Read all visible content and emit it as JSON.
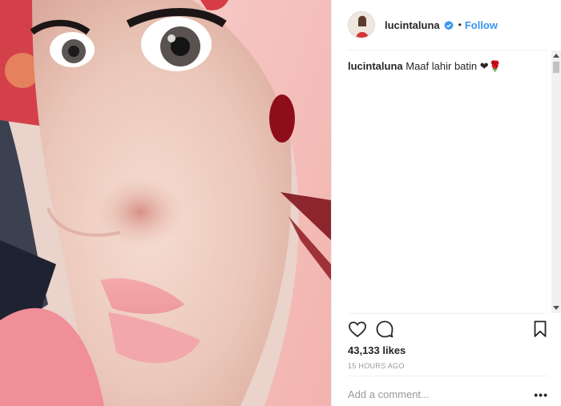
{
  "post": {
    "username": "lucintaluna",
    "verified": true,
    "follow_label": "Follow",
    "separator": "•",
    "caption": {
      "author": "lucintaluna",
      "text": "Maaf lahir batin",
      "emoji": "❤🌹"
    },
    "likes": "43,133 likes",
    "timestamp": "15 HOURS AGO",
    "comment_placeholder": "Add a comment...",
    "more_label": "•••"
  },
  "icons": {
    "like": "heart-icon",
    "comment": "comment-icon",
    "save": "bookmark-icon",
    "verified": "verified-badge-icon"
  },
  "colors": {
    "link": "#3897f0",
    "verified": "#3897f0",
    "text": "#262626",
    "muted": "#999999"
  }
}
